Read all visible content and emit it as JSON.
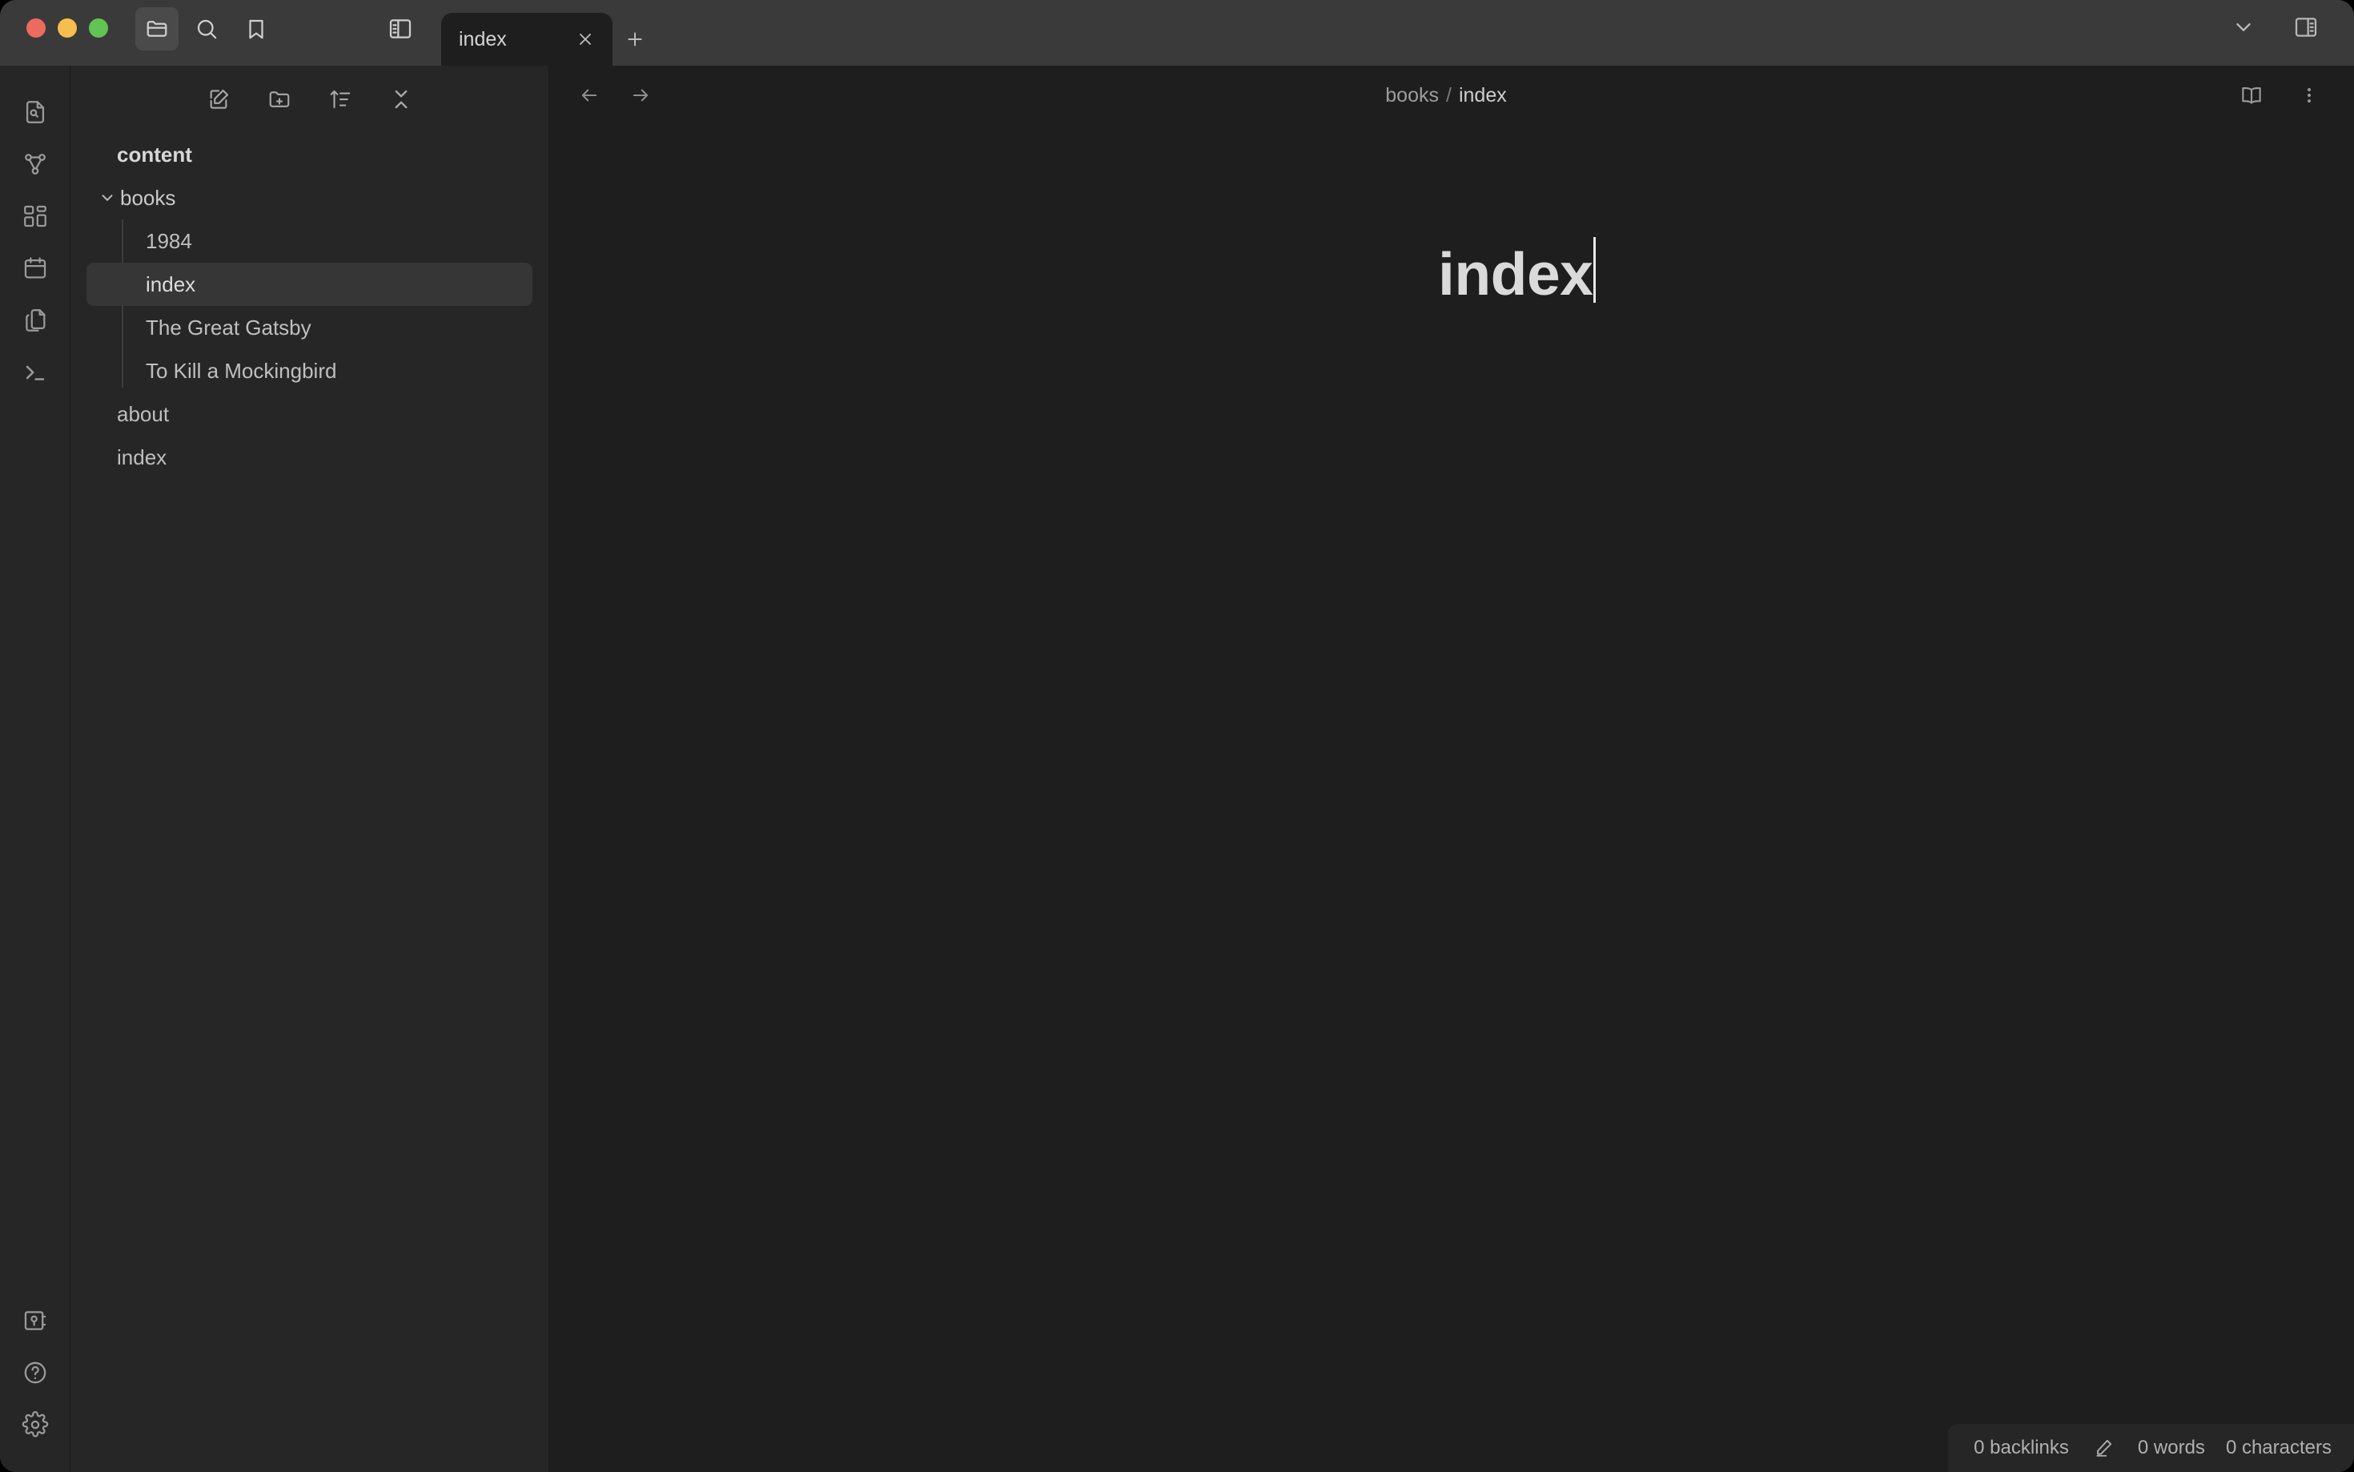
{
  "window": {
    "traffic_lights": [
      "close",
      "minimize",
      "maximize"
    ],
    "colors": {
      "titlebar_bg": "#3a3a3a",
      "sidebar_bg": "#262626",
      "editor_bg": "#1e1e1e",
      "selected_row_bg": "#363636",
      "close_dot": "#ed6a5f",
      "minimize_dot": "#f5bf4f",
      "maximize_dot": "#61c454",
      "text_primary": "#dcdcdc",
      "text_muted": "#9d9d9d"
    }
  },
  "titlebar": {
    "left_buttons": [
      {
        "name": "folder-icon",
        "label": "Files",
        "active": true
      },
      {
        "name": "search-icon",
        "label": "Search",
        "active": false
      },
      {
        "name": "bookmark-icon",
        "label": "Bookmarks",
        "active": false
      }
    ],
    "sidebar_toggle_label": "Toggle left sidebar",
    "right_buttons": [
      {
        "name": "chevron-down-icon",
        "label": "More options"
      },
      {
        "name": "right-sidebar-toggle-icon",
        "label": "Toggle right sidebar"
      }
    ]
  },
  "tabs": {
    "items": [
      {
        "title": "index",
        "active": true,
        "close_label": "Close tab"
      }
    ],
    "new_tab_label": "New tab"
  },
  "ribbon": {
    "top_items": [
      {
        "name": "file-search-icon",
        "label": "Quick switcher"
      },
      {
        "name": "graph-view-icon",
        "label": "Open graph view"
      },
      {
        "name": "canvas-icon",
        "label": "Create new canvas"
      },
      {
        "name": "calendar-icon",
        "label": "Open daily note"
      },
      {
        "name": "files-copy-icon",
        "label": "Open templates"
      },
      {
        "name": "terminal-icon",
        "label": "Open terminal"
      }
    ],
    "bottom_items": [
      {
        "name": "vault-icon",
        "label": "Open another vault"
      },
      {
        "name": "help-icon",
        "label": "Help"
      },
      {
        "name": "settings-gear-icon",
        "label": "Settings"
      }
    ]
  },
  "explorer": {
    "toolbar": [
      {
        "name": "new-note-icon",
        "label": "New note"
      },
      {
        "name": "new-folder-icon",
        "label": "New folder"
      },
      {
        "name": "sort-icon",
        "label": "Change sort order"
      },
      {
        "name": "collapse-all-icon",
        "label": "Collapse all"
      }
    ],
    "vault_name": "content",
    "tree": [
      {
        "label": "books",
        "type": "folder",
        "expanded": true,
        "children": [
          {
            "label": "1984",
            "type": "file",
            "selected": false
          },
          {
            "label": "index",
            "type": "file",
            "selected": true
          },
          {
            "label": "The Great Gatsby",
            "type": "file",
            "selected": false
          },
          {
            "label": "To Kill a Mockingbird",
            "type": "file",
            "selected": false
          }
        ]
      },
      {
        "label": "about",
        "type": "file",
        "selected": false
      },
      {
        "label": "index",
        "type": "file",
        "selected": false
      }
    ]
  },
  "view_header": {
    "back_label": "Navigate back",
    "forward_label": "Navigate forward",
    "breadcrumb": {
      "parent": "books",
      "separator": "/",
      "current": "index"
    },
    "actions": [
      {
        "name": "reading-view-icon",
        "label": "Current view: editing"
      },
      {
        "name": "more-options-icon",
        "label": "More options"
      }
    ]
  },
  "editor": {
    "note_title": "index",
    "caret_visible": true,
    "body_text": ""
  },
  "status_bar": {
    "backlinks": "0 backlinks",
    "edit_mode_icon": "pencil-icon",
    "words": "0 words",
    "characters": "0 characters"
  }
}
